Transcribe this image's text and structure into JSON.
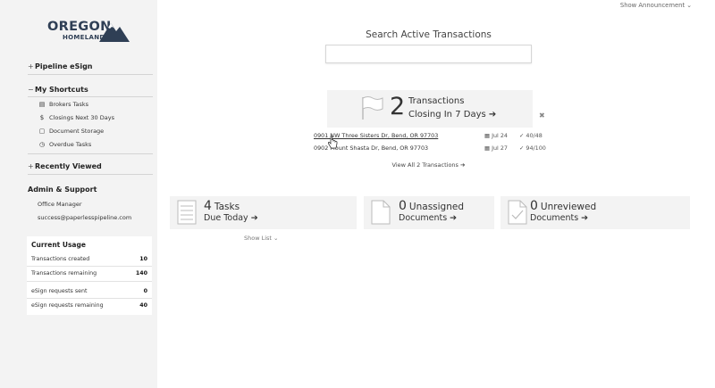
{
  "logo": {
    "line1": "OREGON",
    "line2": "HOMELAND",
    "brand_color": "#2f3f55"
  },
  "sidebar": {
    "pipeline_esign": "Pipeline eSign",
    "my_shortcuts": "My Shortcuts",
    "shortcuts": [
      {
        "label": "Brokers Tasks",
        "icon": "clipboard-icon"
      },
      {
        "label": "Closings Next 30 Days",
        "icon": "dollar-icon"
      },
      {
        "label": "Document Storage",
        "icon": "file-icon"
      },
      {
        "label": "Overdue Tasks",
        "icon": "clock-icon"
      }
    ],
    "recently_viewed": "Recently Viewed",
    "admin_support": "Admin & Support",
    "office_manager": "Office Manager",
    "email": "success@paperlesspipeline.com"
  },
  "usage": {
    "title": "Current Usage",
    "rows": [
      {
        "label": "Transactions created",
        "value": "10"
      },
      {
        "label": "Transactions remaining",
        "value": "140"
      },
      {
        "label": "eSign requests sent",
        "value": "0"
      },
      {
        "label": "eSign requests remaining",
        "value": "40"
      }
    ]
  },
  "header": {
    "announcement": "Show Announcement ⌄"
  },
  "search": {
    "title": "Search Active Transactions",
    "placeholder": ""
  },
  "closing_card": {
    "count": "2",
    "line1": "Transactions",
    "line2": "Closing In 7 Days ➔"
  },
  "transactions": [
    {
      "address": "0901 NW Three Sisters Dr, Bend, OR 97703",
      "date": "Jul 24",
      "progress": "40/48"
    },
    {
      "address": "0902 Mount Shasta Dr, Bend, OR 97703",
      "date": "Jul 27",
      "progress": "94/100"
    }
  ],
  "view_all": "View All 2 Transactions ➔",
  "stats": {
    "tasks": {
      "count": "4",
      "line1": "Tasks",
      "line2": "Due Today ➔"
    },
    "unassigned": {
      "count": "0",
      "line1": "Unassigned",
      "line2": "Documents ➔"
    },
    "unreviewed": {
      "count": "0",
      "line1": "Unreviewed",
      "line2": "Documents ➔"
    }
  },
  "show_list": "Show List ⌄"
}
